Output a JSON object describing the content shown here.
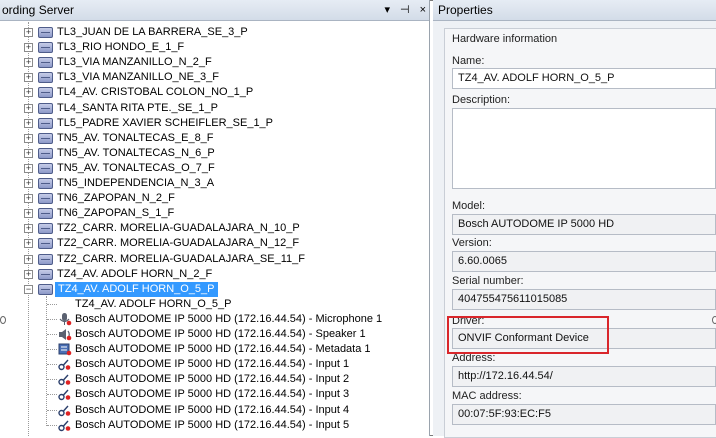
{
  "left_pane": {
    "title": "ording Server",
    "controls": [
      "▾",
      "⊣",
      "×"
    ],
    "servers": [
      "TL3_JUAN DE LA BARRERA_SE_3_P",
      "TL3_RIO HONDO_E_1_F",
      "TL3_VIA MANZANILLO_N_2_F",
      "TL3_VIA MANZANILLO_NE_3_F",
      "TL4_AV. CRISTOBAL COLON_NO_1_P",
      "TL4_SANTA RITA PTE._SE_1_P",
      "TL5_PADRE XAVIER SCHEIFLER_SE_1_P",
      "TN5_AV. TONALTECAS_E_8_F",
      "TN5_AV. TONALTECAS_N_6_P",
      "TN5_AV. TONALTECAS_O_7_F",
      "TN5_INDEPENDENCIA_N_3_A",
      "TN6_ZAPOPAN_N_2_F",
      "TN6_ZAPOPAN_S_1_F",
      "TZ2_CARR. MORELIA-GUADALAJARA_N_10_P",
      "TZ2_CARR. MORELIA-GUADALAJARA_N_12_F",
      "TZ2_CARR. MORELIA-GUADALAJARA_SE_11_F",
      "TZ4_AV. ADOLF HORN_N_2_F"
    ],
    "selected_server": "TZ4_AV. ADOLF HORN_O_5_P",
    "children": [
      {
        "label": "TZ4_AV. ADOLF HORN_O_5_P",
        "icon": "camera-device-icon"
      },
      {
        "label": "Bosch AUTODOME IP 5000 HD (172.16.44.54) - Microphone 1",
        "icon": "microphone-icon"
      },
      {
        "label": "Bosch AUTODOME IP 5000 HD (172.16.44.54) - Speaker 1",
        "icon": "speaker-icon"
      },
      {
        "label": "Bosch AUTODOME IP 5000 HD (172.16.44.54) - Metadata 1",
        "icon": "metadata-icon"
      },
      {
        "label": "Bosch AUTODOME IP 5000 HD (172.16.44.54) - Input 1",
        "icon": "input-icon"
      },
      {
        "label": "Bosch AUTODOME IP 5000 HD (172.16.44.54) - Input 2",
        "icon": "input-icon"
      },
      {
        "label": "Bosch AUTODOME IP 5000 HD (172.16.44.54) - Input 3",
        "icon": "input-icon"
      },
      {
        "label": "Bosch AUTODOME IP 5000 HD (172.16.44.54) - Input 4",
        "icon": "input-icon"
      },
      {
        "label": "Bosch AUTODOME IP 5000 HD (172.16.44.54) - Input 5",
        "icon": "input-icon"
      }
    ]
  },
  "right_pane": {
    "title": "Properties",
    "section": "Hardware information",
    "name_label": "Name:",
    "name_value": "TZ4_AV. ADOLF HORN_O_5_P",
    "description_label": "Description:",
    "description_value": "",
    "model_label": "Model:",
    "model_value": "Bosch AUTODOME IP 5000 HD",
    "version_label": "Version:",
    "version_value": "6.60.0065",
    "serial_label": "Serial number:",
    "serial_value": "404755475611015085",
    "driver_label": "Driver:",
    "driver_value": "ONVIF Conformant Device",
    "address_label": "Address:",
    "address_value": "http://172.16.44.54/",
    "mac_label": "MAC address:",
    "mac_value": "00:07:5F:93:EC:F5"
  },
  "colors": {
    "selection": "#3399ff",
    "highlight_box": "#d9262b"
  }
}
